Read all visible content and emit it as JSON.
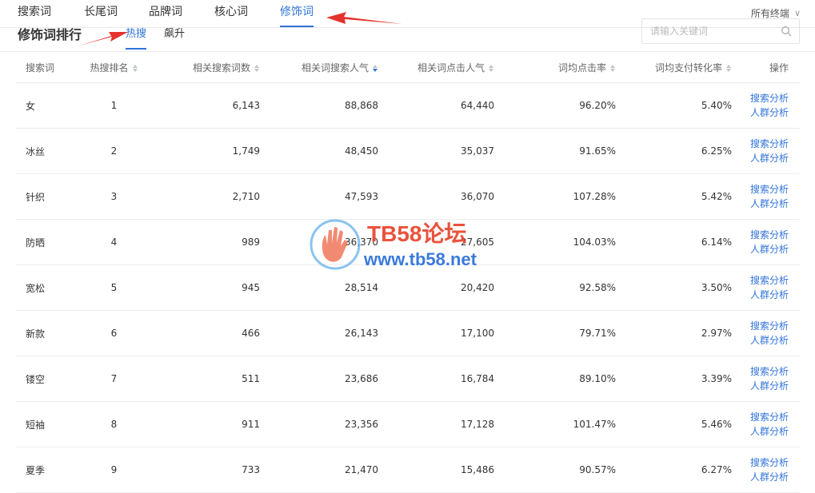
{
  "top_tabs": [
    "搜索词",
    "长尾词",
    "品牌词",
    "核心词",
    "修饰词"
  ],
  "active_top_tab": 4,
  "scope_label": "所有终端",
  "section_title": "修饰词排行",
  "sub_tabs": [
    "热搜",
    "飙升"
  ],
  "active_sub_tab": 0,
  "search": {
    "placeholder": "请输入关键词"
  },
  "table": {
    "columns": [
      "搜索词",
      "热搜排名",
      "相关搜索词数",
      "相关词搜索人气",
      "相关词点击人气",
      "词均点击率",
      "词均支付转化率",
      "操作"
    ],
    "rows": [
      [
        "女",
        "1",
        "6,143",
        "88,868",
        "64,440",
        "96.20%",
        "5.40%"
      ],
      [
        "冰丝",
        "2",
        "1,749",
        "48,450",
        "35,037",
        "91.65%",
        "6.25%"
      ],
      [
        "针织",
        "3",
        "2,710",
        "47,593",
        "36,070",
        "107.28%",
        "5.42%"
      ],
      [
        "防晒",
        "4",
        "989",
        "36,370",
        "27,605",
        "104.03%",
        "6.14%"
      ],
      [
        "宽松",
        "5",
        "945",
        "28,514",
        "20,420",
        "92.58%",
        "3.50%"
      ],
      [
        "新款",
        "6",
        "466",
        "26,143",
        "17,100",
        "79.71%",
        "2.97%"
      ],
      [
        "镂空",
        "7",
        "511",
        "23,686",
        "16,784",
        "89.10%",
        "3.39%"
      ],
      [
        "短袖",
        "8",
        "911",
        "23,356",
        "17,128",
        "101.47%",
        "5.46%"
      ],
      [
        "夏季",
        "9",
        "733",
        "21,470",
        "15,486",
        "90.57%",
        "6.27%"
      ]
    ],
    "actions": [
      "搜索分析",
      "人群分析"
    ]
  },
  "watermark": {
    "title": "TB58论坛",
    "url": "www.tb58.net"
  },
  "colors": {
    "accent": "#3073d9",
    "watermark_red": "#e8452c",
    "watermark_blue": "#2a6fd8",
    "annotation_arrow": "#e5322d"
  }
}
